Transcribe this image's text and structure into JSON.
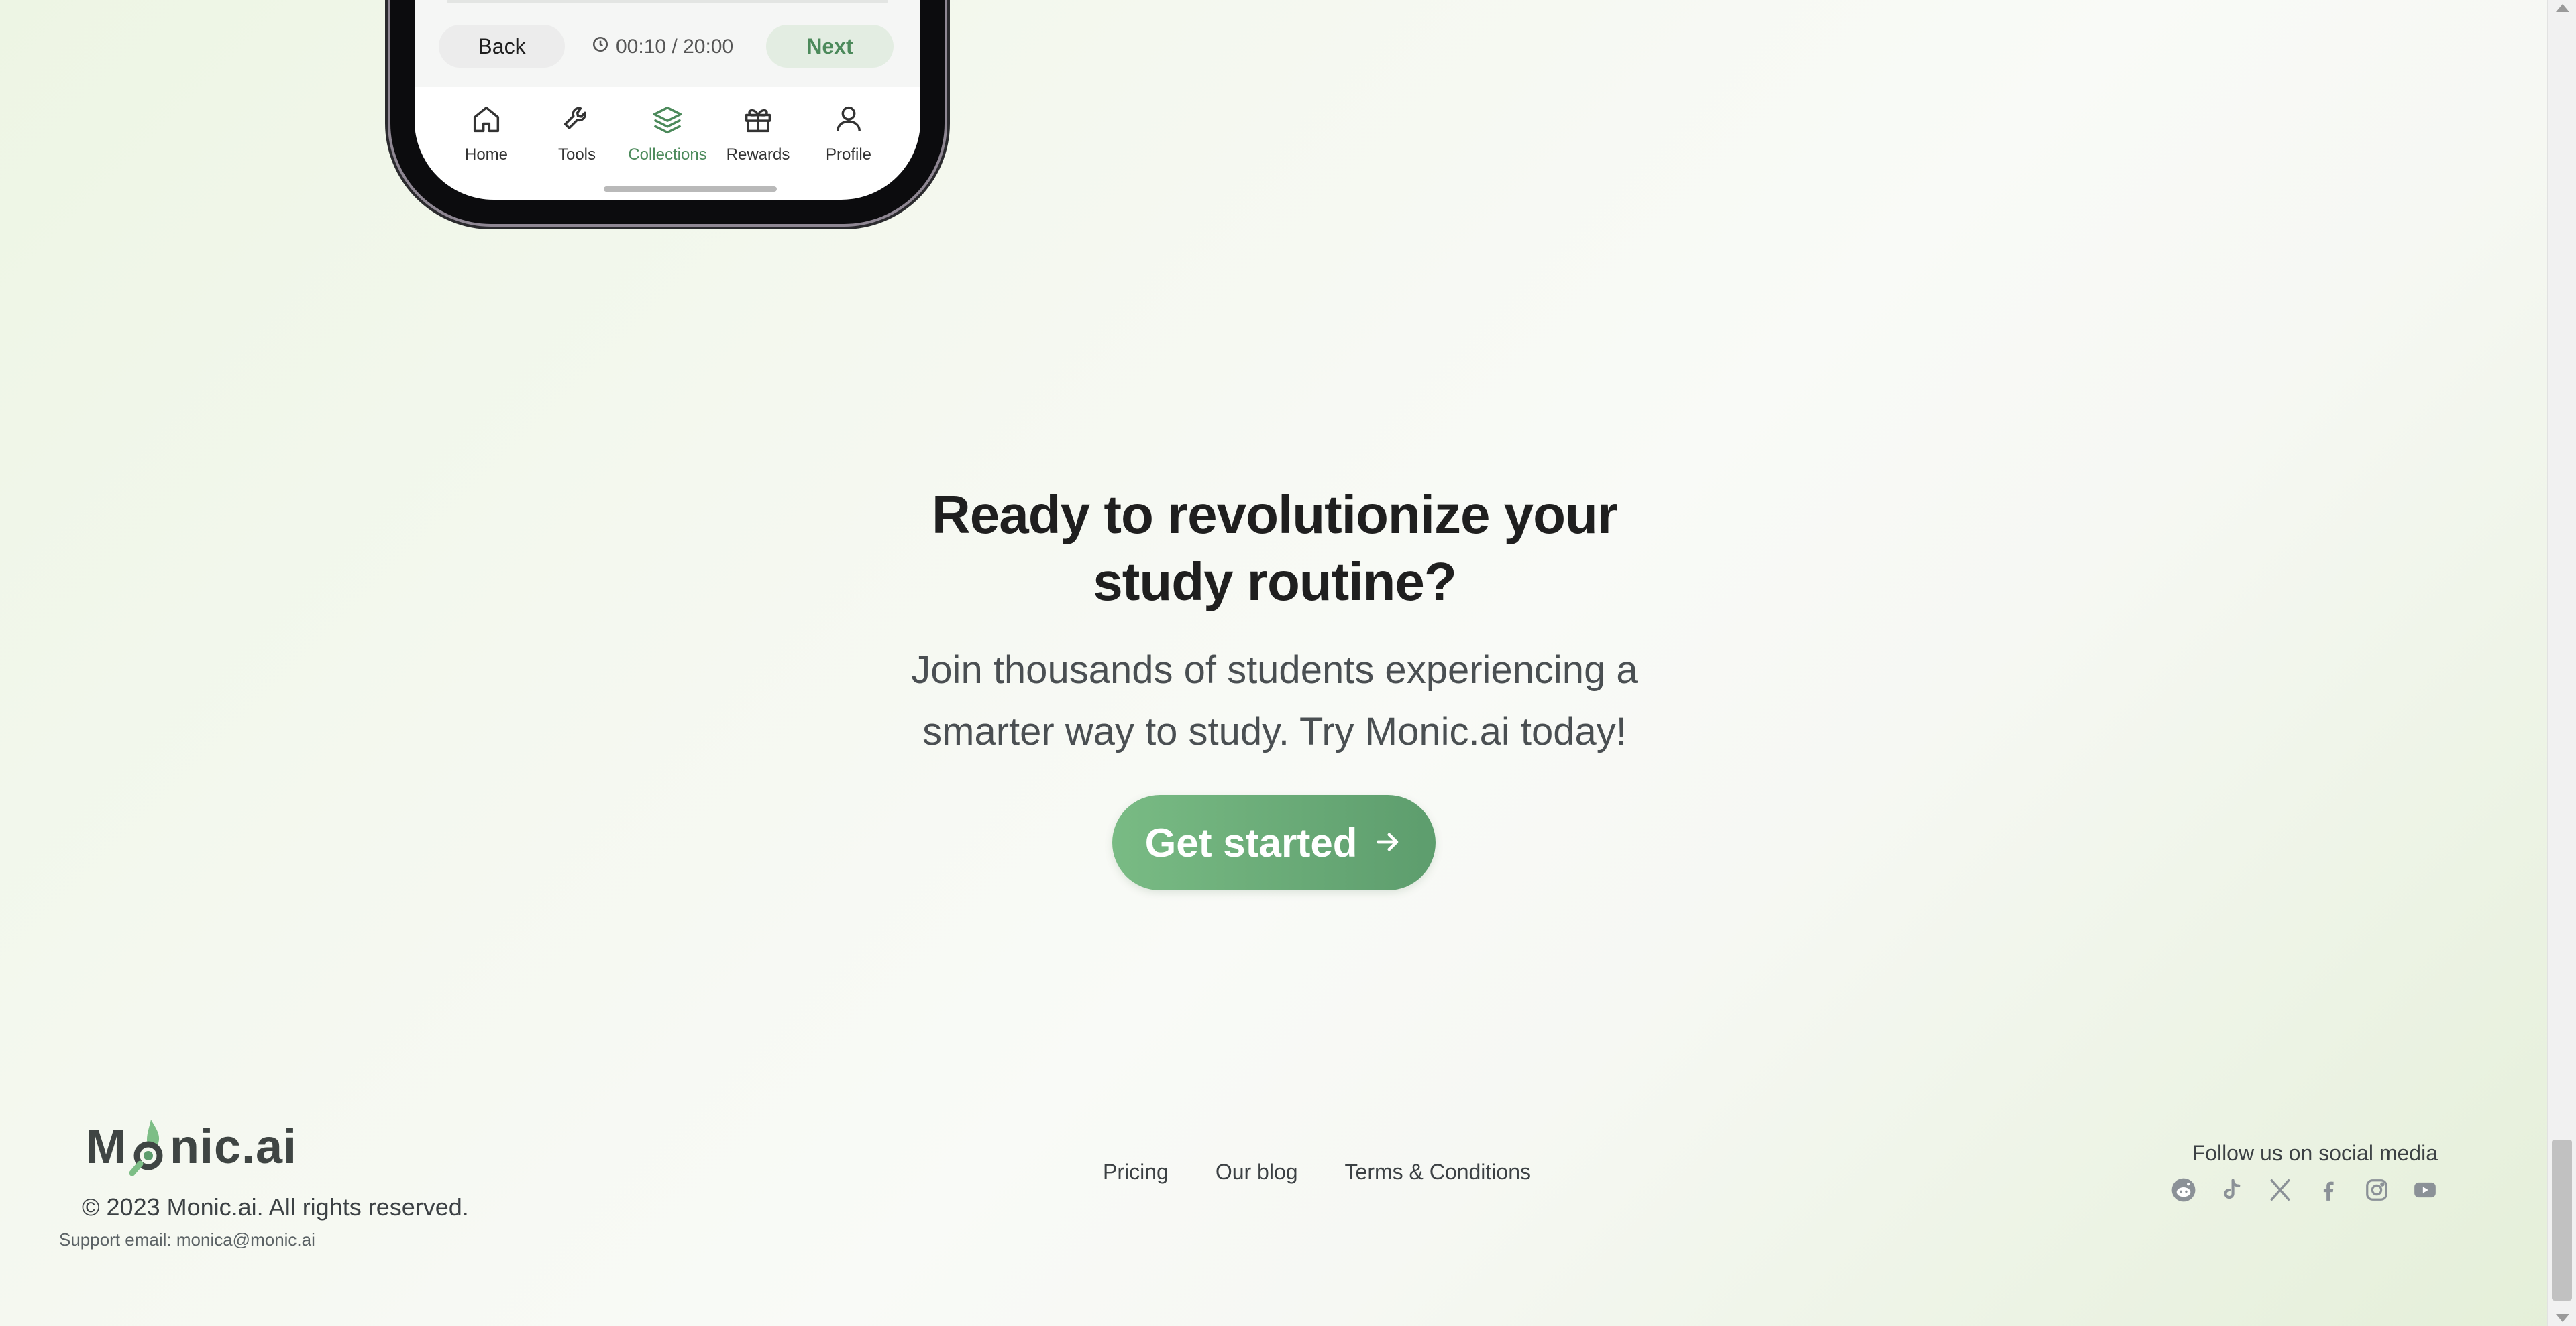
{
  "phone": {
    "back_label": "Back",
    "timer": "00:10 / 20:00",
    "next_label": "Next",
    "tabs": [
      {
        "label": "Home",
        "icon": "home-icon",
        "active": false
      },
      {
        "label": "Tools",
        "icon": "wrench-icon",
        "active": false
      },
      {
        "label": "Collections",
        "icon": "layers-icon",
        "active": true
      },
      {
        "label": "Rewards",
        "icon": "gift-icon",
        "active": false
      },
      {
        "label": "Profile",
        "icon": "user-icon",
        "active": false
      }
    ]
  },
  "cta": {
    "title_line1": "Ready to revolutionize your",
    "title_line2": "study routine?",
    "subtitle_line1": "Join thousands of students experiencing a",
    "subtitle_line2": "smarter way to study. Try Monic.ai today!",
    "button_label": "Get started"
  },
  "footer": {
    "logo_prefix": "M",
    "logo_suffix": "nic.ai",
    "copyright": "© 2023 Monic.ai. All rights reserved.",
    "support": "Support email: monica@monic.ai",
    "links": [
      "Pricing",
      "Our blog",
      "Terms & Conditions"
    ],
    "follow_label": "Follow us on social media",
    "social": [
      "reddit-icon",
      "tiktok-icon",
      "x-icon",
      "facebook-icon",
      "instagram-icon",
      "youtube-icon"
    ]
  },
  "colors": {
    "accent_green": "#5d9d6d",
    "active_tab": "#4c8a5b",
    "heading": "#1f1f1f",
    "body_text": "#4a4f52",
    "icon_gray": "#8b9197"
  }
}
